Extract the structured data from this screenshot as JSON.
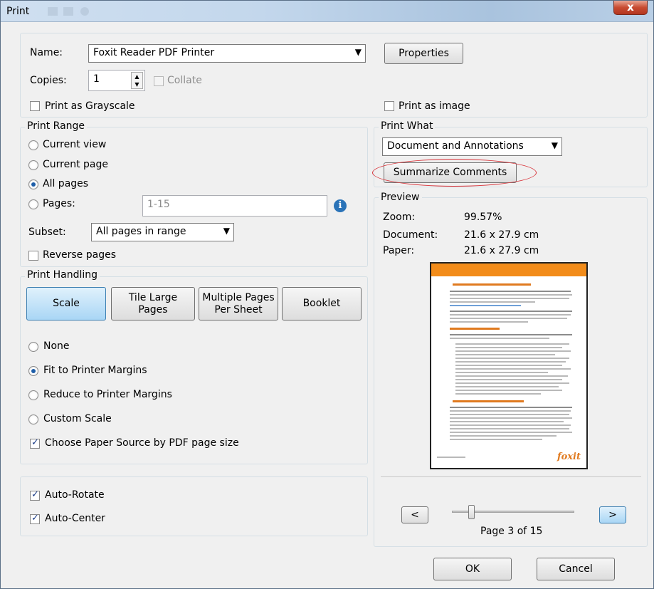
{
  "window": {
    "title": "Print",
    "close_glyph": "x"
  },
  "printer": {
    "name_label": "Name:",
    "name_value": "Foxit Reader PDF Printer",
    "properties_label": "Properties",
    "copies_label": "Copies:",
    "copies_value": "1",
    "collate_label": "Collate",
    "grayscale_label": "Print as Grayscale",
    "print_as_image_label": "Print as image"
  },
  "print_range": {
    "title": "Print Range",
    "options": [
      "Current view",
      "Current page",
      "All pages",
      "Pages:"
    ],
    "selected": "All pages",
    "pages_value": "1-15",
    "subset_label": "Subset:",
    "subset_value": "All pages in range",
    "reverse_label": "Reverse pages"
  },
  "print_handling": {
    "title": "Print Handling",
    "tabs": [
      {
        "label": "Scale",
        "active": true
      },
      {
        "label": "Tile Large Pages",
        "active": false
      },
      {
        "label": "Multiple Pages Per Sheet",
        "active": false
      },
      {
        "label": "Booklet",
        "active": false
      }
    ],
    "scale_options": [
      "None",
      "Fit to Printer Margins",
      "Reduce to Printer Margins",
      "Custom Scale"
    ],
    "selected": "Fit to Printer Margins",
    "paper_source_label": "Choose Paper Source by PDF page size",
    "paper_source_checked": true
  },
  "orientation": {
    "auto_rotate_label": "Auto-Rotate",
    "auto_rotate_checked": true,
    "auto_center_label": "Auto-Center",
    "auto_center_checked": true
  },
  "print_what": {
    "title": "Print What",
    "value": "Document and Annotations",
    "summarize_label": "Summarize Comments"
  },
  "preview": {
    "title": "Preview",
    "zoom_label": "Zoom:",
    "zoom_value": "99.57%",
    "document_label": "Document:",
    "document_value": "21.6 x 27.9 cm",
    "paper_label": "Paper:",
    "paper_value": "21.6 x 27.9 cm",
    "prev_label": "<",
    "next_label": ">",
    "page_indicator": "Page 3 of 15",
    "page_position": 0.14
  },
  "buttons": {
    "ok": "OK",
    "cancel": "Cancel"
  },
  "colors": {
    "accent_oval": "#d9343a",
    "thumbnail_header": "#f28c1a",
    "selected_tab": "#a9d6f5"
  }
}
